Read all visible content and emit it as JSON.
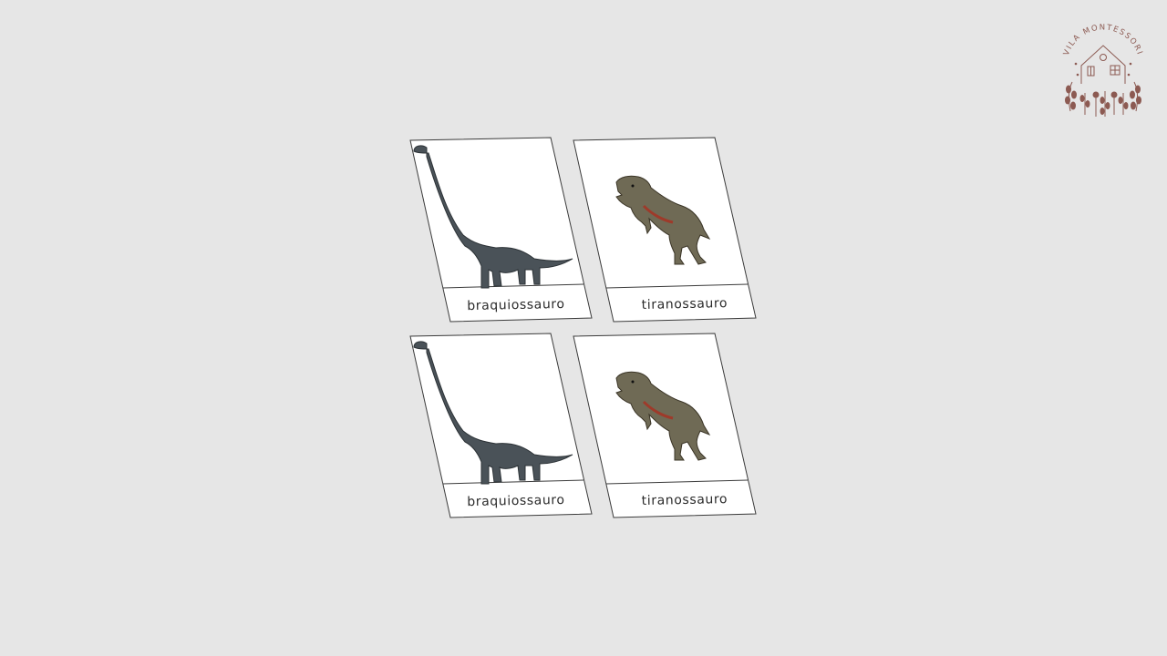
{
  "brand": {
    "logo_text": "VILA MONTESSORI",
    "logo_icon": "house-with-plants-icon",
    "color": "#8c5a52"
  },
  "cards": [
    {
      "label": "braquiossauro",
      "image": "brachiosaurus-image"
    },
    {
      "label": "tiranossauro",
      "image": "tyrannosaurus-image"
    },
    {
      "label": "braquiossauro",
      "image": "brachiosaurus-image"
    },
    {
      "label": "tiranossauro",
      "image": "tyrannosaurus-image"
    }
  ],
  "colors": {
    "background": "#e6e6e6",
    "card": "#ffffff",
    "border": "#3a3a3a"
  }
}
